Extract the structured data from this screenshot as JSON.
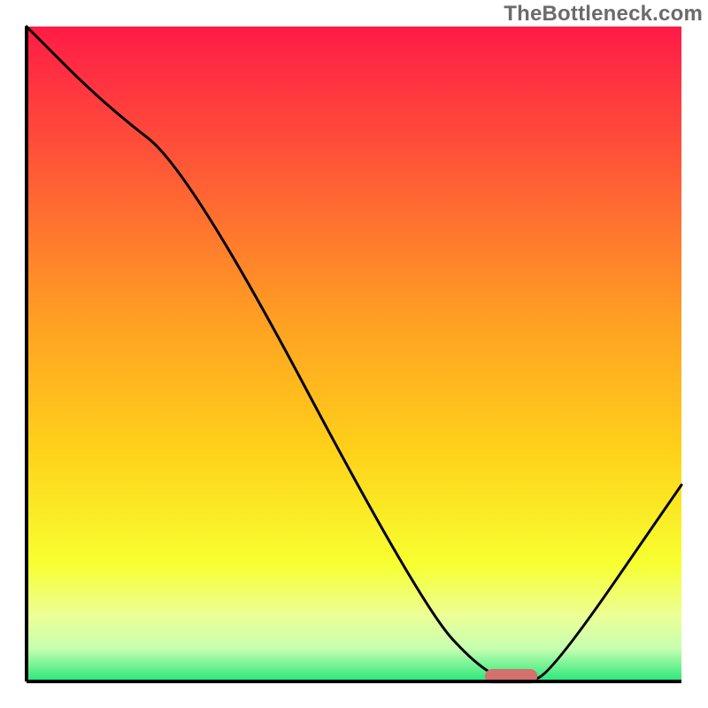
{
  "watermark": "TheBottleneck.com",
  "chart_data": {
    "type": "line",
    "title": "",
    "xlabel": "",
    "ylabel": "",
    "xlim": [
      0,
      100
    ],
    "ylim": [
      0,
      100
    ],
    "x": [
      0,
      12,
      25,
      60,
      70,
      76,
      80,
      100
    ],
    "values": [
      100,
      88,
      78,
      12,
      1,
      0,
      1,
      30
    ],
    "marker": {
      "x": 74,
      "y": 0.8,
      "width": 8,
      "height": 2.2,
      "color": "#d4706e"
    },
    "gradient_stops": [
      {
        "offset": 0.0,
        "color": "#ff1b47"
      },
      {
        "offset": 0.2,
        "color": "#ff5438"
      },
      {
        "offset": 0.45,
        "color": "#ffa022"
      },
      {
        "offset": 0.65,
        "color": "#ffd21a"
      },
      {
        "offset": 0.82,
        "color": "#f7ff30"
      },
      {
        "offset": 0.9,
        "color": "#ecff97"
      },
      {
        "offset": 0.95,
        "color": "#c6ffb0"
      },
      {
        "offset": 1.0,
        "color": "#27e67a"
      }
    ],
    "axis_color": "#000000",
    "line_color": "#000000",
    "line_width": 3
  }
}
